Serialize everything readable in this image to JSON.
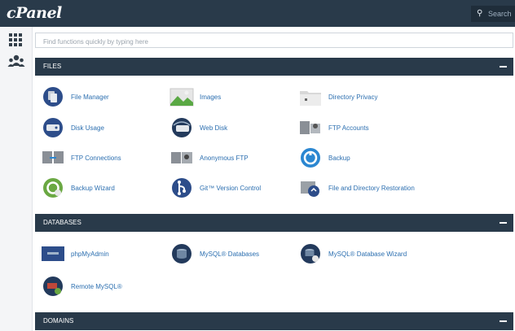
{
  "header": {
    "logo": "cPanel",
    "search_placeholder": "Search"
  },
  "filter": {
    "placeholder": "Find functions quickly by typing here"
  },
  "sections": [
    {
      "title": "FILES",
      "items": [
        {
          "label": "File Manager",
          "icon": "file-manager-icon"
        },
        {
          "label": "Images",
          "icon": "images-icon"
        },
        {
          "label": "Directory Privacy",
          "icon": "directory-privacy-icon"
        },
        {
          "label": "Disk Usage",
          "icon": "disk-usage-icon"
        },
        {
          "label": "Web Disk",
          "icon": "web-disk-icon"
        },
        {
          "label": "FTP Accounts",
          "icon": "ftp-accounts-icon"
        },
        {
          "label": "FTP Connections",
          "icon": "ftp-connections-icon"
        },
        {
          "label": "Anonymous FTP",
          "icon": "anonymous-ftp-icon"
        },
        {
          "label": "Backup",
          "icon": "backup-icon"
        },
        {
          "label": "Backup Wizard",
          "icon": "backup-wizard-icon"
        },
        {
          "label": "Git™ Version Control",
          "icon": "git-icon"
        },
        {
          "label": "File and Directory Restoration",
          "icon": "file-restoration-icon"
        }
      ]
    },
    {
      "title": "DATABASES",
      "items": [
        {
          "label": "phpMyAdmin",
          "icon": "phpmyadmin-icon"
        },
        {
          "label": "MySQL® Databases",
          "icon": "mysql-databases-icon"
        },
        {
          "label": "MySQL® Database Wizard",
          "icon": "mysql-wizard-icon"
        },
        {
          "label": "Remote MySQL®",
          "icon": "remote-mysql-icon"
        }
      ]
    },
    {
      "title": "DOMAINS",
      "items": []
    }
  ],
  "colors": {
    "header_bg": "#293a4a",
    "link": "#2c6fb0",
    "accent_blue": "#2b87d1"
  }
}
